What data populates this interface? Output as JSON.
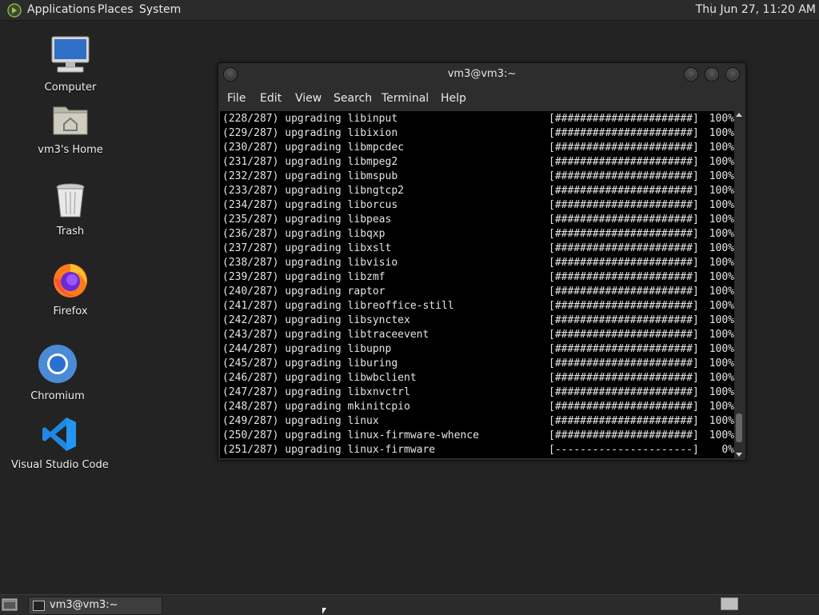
{
  "top_panel": {
    "menus": [
      "Applications",
      "Places",
      "System"
    ],
    "clock": "Thu Jun 27, 11:20 AM"
  },
  "desktop_icons": [
    {
      "label": "Computer",
      "icon": "computer-icon"
    },
    {
      "label": "vm3's Home",
      "icon": "home-folder-icon"
    },
    {
      "label": "Trash",
      "icon": "trash-icon"
    },
    {
      "label": "Firefox",
      "icon": "firefox-icon"
    },
    {
      "label": "Chromium",
      "icon": "chromium-icon"
    },
    {
      "label": "Visual Studio Code",
      "icon": "vscode-icon"
    }
  ],
  "terminal": {
    "title": "vm3@vm3:~",
    "menu": [
      "File",
      "Edit",
      "View",
      "Search",
      "Terminal",
      "Help"
    ],
    "lines": [
      {
        "n": "(228/287)",
        "text": "upgrading libinput",
        "bar": "[######################]",
        "pct": "100%"
      },
      {
        "n": "(229/287)",
        "text": "upgrading libixion",
        "bar": "[######################]",
        "pct": "100%"
      },
      {
        "n": "(230/287)",
        "text": "upgrading libmpcdec",
        "bar": "[######################]",
        "pct": "100%"
      },
      {
        "n": "(231/287)",
        "text": "upgrading libmpeg2",
        "bar": "[######################]",
        "pct": "100%"
      },
      {
        "n": "(232/287)",
        "text": "upgrading libmspub",
        "bar": "[######################]",
        "pct": "100%"
      },
      {
        "n": "(233/287)",
        "text": "upgrading libngtcp2",
        "bar": "[######################]",
        "pct": "100%"
      },
      {
        "n": "(234/287)",
        "text": "upgrading liborcus",
        "bar": "[######################]",
        "pct": "100%"
      },
      {
        "n": "(235/287)",
        "text": "upgrading libpeas",
        "bar": "[######################]",
        "pct": "100%"
      },
      {
        "n": "(236/287)",
        "text": "upgrading libqxp",
        "bar": "[######################]",
        "pct": "100%"
      },
      {
        "n": "(237/287)",
        "text": "upgrading libxslt",
        "bar": "[######################]",
        "pct": "100%"
      },
      {
        "n": "(238/287)",
        "text": "upgrading libvisio",
        "bar": "[######################]",
        "pct": "100%"
      },
      {
        "n": "(239/287)",
        "text": "upgrading libzmf",
        "bar": "[######################]",
        "pct": "100%"
      },
      {
        "n": "(240/287)",
        "text": "upgrading raptor",
        "bar": "[######################]",
        "pct": "100%"
      },
      {
        "n": "(241/287)",
        "text": "upgrading libreoffice-still",
        "bar": "[######################]",
        "pct": "100%"
      },
      {
        "n": "(242/287)",
        "text": "upgrading libsynctex",
        "bar": "[######################]",
        "pct": "100%"
      },
      {
        "n": "(243/287)",
        "text": "upgrading libtraceevent",
        "bar": "[######################]",
        "pct": "100%"
      },
      {
        "n": "(244/287)",
        "text": "upgrading libupnp",
        "bar": "[######################]",
        "pct": "100%"
      },
      {
        "n": "(245/287)",
        "text": "upgrading liburing",
        "bar": "[######################]",
        "pct": "100%"
      },
      {
        "n": "(246/287)",
        "text": "upgrading libwbclient",
        "bar": "[######################]",
        "pct": "100%"
      },
      {
        "n": "(247/287)",
        "text": "upgrading libxnvctrl",
        "bar": "[######################]",
        "pct": "100%"
      },
      {
        "n": "(248/287)",
        "text": "upgrading mkinitcpio",
        "bar": "[######################]",
        "pct": "100%"
      },
      {
        "n": "(249/287)",
        "text": "upgrading linux",
        "bar": "[######################]",
        "pct": "100%"
      },
      {
        "n": "(250/287)",
        "text": "upgrading linux-firmware-whence",
        "bar": "[######################]",
        "pct": "100%"
      },
      {
        "n": "(251/287)",
        "text": "upgrading linux-firmware",
        "bar": "[----------------------]",
        "pct": "0%"
      }
    ]
  },
  "taskbar": {
    "task_label": "vm3@vm3:~"
  }
}
